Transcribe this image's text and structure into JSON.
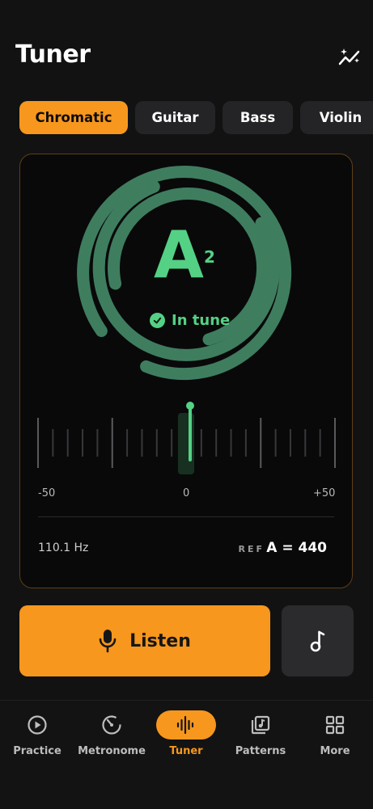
{
  "header": {
    "title": "Tuner",
    "insights_icon": "sparkle-chart-icon"
  },
  "modes": [
    "Chromatic",
    "Guitar",
    "Bass",
    "Violin"
  ],
  "selected_mode": "Chromatic",
  "tuner": {
    "note": "A",
    "octave": "2",
    "status": "In tune",
    "scale_min": "-50",
    "scale_mid": "0",
    "scale_max": "+50",
    "cents_offset": 0,
    "frequency": "110.1 Hz",
    "ref_label": "REF",
    "ref_value": "A = 440"
  },
  "actions": {
    "listen_label": "Listen",
    "listen_icon": "microphone-icon",
    "note_icon": "music-note-icon"
  },
  "nav": [
    {
      "label": "Practice",
      "icon": "play-circle-icon",
      "active": false
    },
    {
      "label": "Metronome",
      "icon": "metronome-icon",
      "active": false
    },
    {
      "label": "Tuner",
      "icon": "waveform-icon",
      "active": true
    },
    {
      "label": "Patterns",
      "icon": "music-library-icon",
      "active": false
    },
    {
      "label": "More",
      "icon": "grid-icon",
      "active": false
    }
  ],
  "colors": {
    "accent": "#f7971d",
    "in_tune": "#54d184",
    "ring": "#3f7d5f",
    "background": "#121212"
  }
}
